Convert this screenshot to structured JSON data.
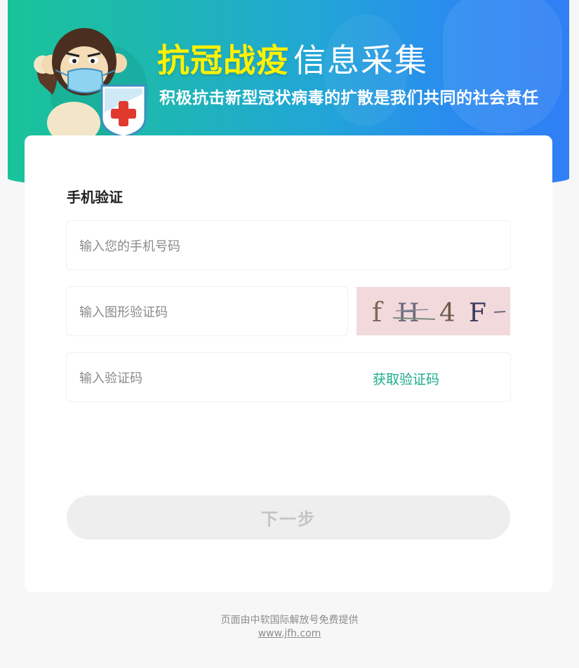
{
  "banner": {
    "title_highlight": "抗冠战疫",
    "title_rest": "信息采集",
    "subtitle": "积极抗击新型冠状病毒的扩散是我们共同的社会责任"
  },
  "form": {
    "section_title": "手机验证",
    "phone_placeholder": "输入您的手机号码",
    "captcha_placeholder": "输入图形验证码",
    "captcha_image_text": "f H 4 F",
    "code_placeholder": "输入验证码",
    "get_code_label": "获取验证码",
    "next_label": "下一步"
  },
  "footer": {
    "provider_text": "页面由中软国际解放号免费提供",
    "link_text": "www.jfh.com"
  },
  "colors": {
    "accent_green": "#1aad8a",
    "title_yellow": "#fff200",
    "banner_start": "#19c39a",
    "banner_end": "#2f7ff5"
  }
}
